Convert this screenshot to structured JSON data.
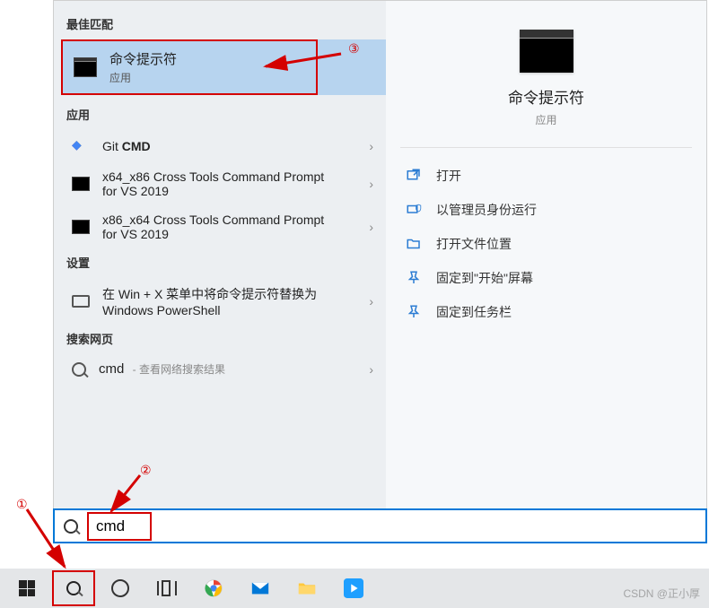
{
  "sections": {
    "best_match": "最佳匹配",
    "apps": "应用",
    "settings": "设置",
    "web": "搜索网页"
  },
  "best_match_item": {
    "title": "命令提示符",
    "subtitle": "应用"
  },
  "apps": [
    {
      "label_prefix": "Git ",
      "label_bold": "CMD"
    },
    {
      "label": "x64_x86 Cross Tools Command Prompt for VS 2019"
    },
    {
      "label": "x86_x64 Cross Tools Command Prompt for VS 2019"
    }
  ],
  "settings": [
    {
      "label": "在 Win + X 菜单中将命令提示符替换为 Windows PowerShell"
    }
  ],
  "web": {
    "query": "cmd",
    "suffix": " - 查看网络搜索结果"
  },
  "preview": {
    "title": "命令提示符",
    "subtitle": "应用"
  },
  "actions": [
    {
      "label": "打开"
    },
    {
      "label": "以管理员身份运行"
    },
    {
      "label": "打开文件位置"
    },
    {
      "label": "固定到\"开始\"屏幕"
    },
    {
      "label": "固定到任务栏"
    }
  ],
  "search_input": "cmd",
  "annotations": {
    "a1": "①",
    "a2": "②",
    "a3": "③"
  },
  "watermark": "CSDN @正小厚"
}
